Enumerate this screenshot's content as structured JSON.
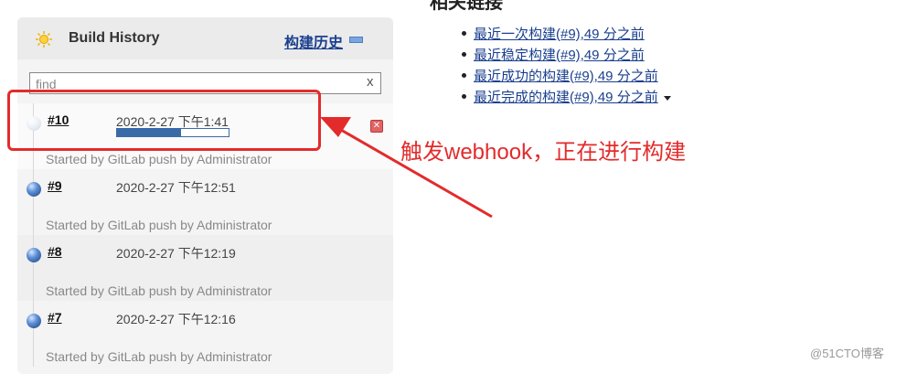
{
  "page": {
    "top_heading": "相关链接"
  },
  "build_history": {
    "title": "Build History",
    "link_label": "构建历史",
    "filter": {
      "value": "find",
      "clear_label": "x"
    },
    "builds": [
      {
        "number": "#10",
        "time": "2020-2-27 下午1:41",
        "cause": "Started by GitLab push by Administrator",
        "in_progress": true,
        "progress": 0.57
      },
      {
        "number": "#9",
        "time": "2020-2-27 下午12:51",
        "cause": "Started by GitLab push by Administrator",
        "in_progress": false
      },
      {
        "number": "#8",
        "time": "2020-2-27 下午12:19",
        "cause": "Started by GitLab push by Administrator",
        "in_progress": false
      },
      {
        "number": "#7",
        "time": "2020-2-27 下午12:16",
        "cause": "Started by GitLab push by Administrator",
        "in_progress": false
      }
    ]
  },
  "related_links": [
    "最近一次构建(#9),49 分之前",
    "最近稳定构建(#9),49 分之前",
    "最近成功的构建(#9),49 分之前",
    "最近完成的构建(#9),49 分之前"
  ],
  "annotation": {
    "text": "触发webhook，正在进行构建",
    "color": "#e32b2b"
  },
  "watermark": "@51CTO博客",
  "colors": {
    "link": "#1a3f8f",
    "progress": "#3b6aa8",
    "panel_bg": "#f4f4f4"
  },
  "icons": [
    "sun-icon",
    "collapse-icon",
    "status-ball-icon",
    "cancel-build-icon",
    "dropdown-caret-icon"
  ]
}
